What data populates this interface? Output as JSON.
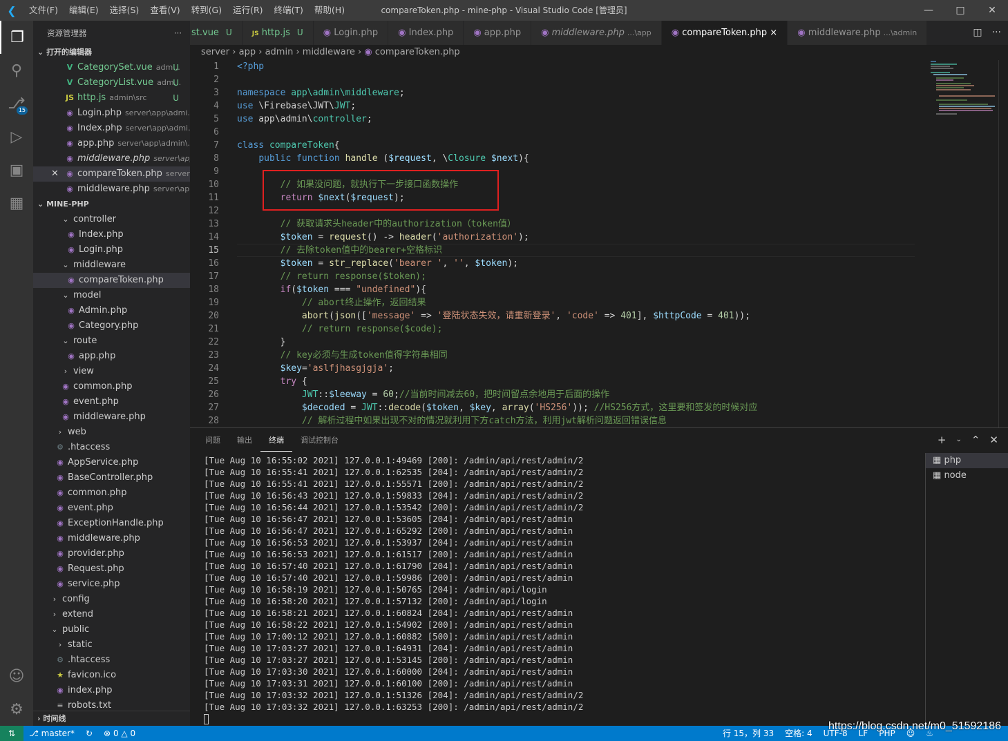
{
  "titlebar": {
    "menus": [
      "文件(F)",
      "编辑(E)",
      "选择(S)",
      "查看(V)",
      "转到(G)",
      "运行(R)",
      "终端(T)",
      "帮助(H)"
    ],
    "title": "compareToken.php - mine-php - Visual Studio Code [管理员]"
  },
  "activity": {
    "badge": "15"
  },
  "sidebar": {
    "title": "资源管理器",
    "more": "···",
    "open_editors_label": "打开的编辑器",
    "project_label": "MINE-PHP",
    "timeline_label": "时间线",
    "open_editors": [
      {
        "name": "CategorySet.vue",
        "desc": "adm...",
        "status": "U"
      },
      {
        "name": "CategoryList.vue",
        "desc": "adm...",
        "status": "U"
      },
      {
        "name": "http.js",
        "desc": "admin\\src",
        "status": "U"
      },
      {
        "name": "Login.php",
        "desc": "server\\app\\admi..."
      },
      {
        "name": "Index.php",
        "desc": "server\\app\\admi..."
      },
      {
        "name": "app.php",
        "desc": "server\\app\\admin\\..."
      },
      {
        "name": "middleware.php",
        "desc": "server\\app"
      },
      {
        "name": "compareToken.php",
        "desc": "server\\..."
      },
      {
        "name": "middleware.php",
        "desc": "server\\app..."
      }
    ],
    "tree": [
      "controller",
      "Index.php",
      "Login.php",
      "middleware",
      "compareToken.php",
      "model",
      "Admin.php",
      "Category.php",
      "route",
      "app.php",
      "view",
      "common.php",
      "event.php",
      "middleware.php",
      "web",
      ".htaccess",
      "AppService.php",
      "BaseController.php",
      "common.php",
      "event.php",
      "ExceptionHandle.php",
      "middleware.php",
      "provider.php",
      "Request.php",
      "service.php",
      "config",
      "extend",
      "public",
      "static",
      ".htaccess",
      "favicon.ico",
      "index.php",
      "robots.txt"
    ]
  },
  "tabs": [
    {
      "label": "st.vue",
      "status": "U"
    },
    {
      "label": "http.js",
      "status": "U"
    },
    {
      "label": "Login.php"
    },
    {
      "label": "Index.php"
    },
    {
      "label": "app.php"
    },
    {
      "label": "middleware.php",
      "desc": "...\\app"
    },
    {
      "label": "compareToken.php",
      "close": "×"
    },
    {
      "label": "middleware.php",
      "desc": "...\\admin"
    }
  ],
  "breadcrumb": [
    "server",
    "app",
    "admin",
    "middleware",
    "compareToken.php"
  ],
  "editor": {
    "line_numbers": [
      "1",
      "2",
      "3",
      "4",
      "5",
      "6",
      "7",
      "8",
      "9",
      "10",
      "11",
      "12",
      "13",
      "14",
      "15",
      "16",
      "17",
      "18",
      "19",
      "20",
      "21",
      "22",
      "23",
      "24",
      "25",
      "26",
      "27",
      "28"
    ],
    "current_line": "15"
  },
  "panel": {
    "tabs": [
      "问题",
      "输出",
      "终端",
      "调试控制台"
    ],
    "terminals": [
      "php",
      "node"
    ],
    "log": [
      "[Tue Aug 10 16:55:02 2021] 127.0.0.1:49469 [200]: /admin/api/rest/admin/2",
      "[Tue Aug 10 16:55:41 2021] 127.0.0.1:62535 [204]: /admin/api/rest/admin/2",
      "[Tue Aug 10 16:55:41 2021] 127.0.0.1:55571 [200]: /admin/api/rest/admin/2",
      "[Tue Aug 10 16:56:43 2021] 127.0.0.1:59833 [204]: /admin/api/rest/admin/2",
      "[Tue Aug 10 16:56:44 2021] 127.0.0.1:53542 [200]: /admin/api/rest/admin/2",
      "[Tue Aug 10 16:56:47 2021] 127.0.0.1:53605 [204]: /admin/api/rest/admin",
      "[Tue Aug 10 16:56:47 2021] 127.0.0.1:65292 [200]: /admin/api/rest/admin",
      "[Tue Aug 10 16:56:53 2021] 127.0.0.1:53937 [204]: /admin/api/rest/admin",
      "[Tue Aug 10 16:56:53 2021] 127.0.0.1:61517 [200]: /admin/api/rest/admin",
      "[Tue Aug 10 16:57:40 2021] 127.0.0.1:61790 [204]: /admin/api/rest/admin",
      "[Tue Aug 10 16:57:40 2021] 127.0.0.1:59986 [200]: /admin/api/rest/admin",
      "[Tue Aug 10 16:58:19 2021] 127.0.0.1:50765 [204]: /admin/api/login",
      "[Tue Aug 10 16:58:20 2021] 127.0.0.1:57132 [200]: /admin/api/login",
      "[Tue Aug 10 16:58:21 2021] 127.0.0.1:60824 [204]: /admin/api/rest/admin",
      "[Tue Aug 10 16:58:22 2021] 127.0.0.1:54902 [200]: /admin/api/rest/admin",
      "[Tue Aug 10 17:00:12 2021] 127.0.0.1:60882 [500]: /admin/api/rest/admin",
      "[Tue Aug 10 17:03:27 2021] 127.0.0.1:64931 [204]: /admin/api/rest/admin",
      "[Tue Aug 10 17:03:27 2021] 127.0.0.1:53145 [200]: /admin/api/rest/admin",
      "[Tue Aug 10 17:03:30 2021] 127.0.0.1:60000 [204]: /admin/api/rest/admin",
      "[Tue Aug 10 17:03:31 2021] 127.0.0.1:60100 [200]: /admin/api/rest/admin",
      "[Tue Aug 10 17:03:32 2021] 127.0.0.1:51326 [204]: /admin/api/rest/admin/2",
      "[Tue Aug 10 17:03:32 2021] 127.0.0.1:63253 [200]: /admin/api/rest/admin/2"
    ]
  },
  "statusbar": {
    "branch": "master*",
    "errors": "0",
    "warnings": "0",
    "position": "行 15，列 33",
    "spaces": "空格: 4",
    "encoding": "UTF-8",
    "eol": "LF",
    "language": "PHP"
  },
  "watermark": "https://blog.csdn.net/m0_51592186",
  "colors": {
    "accent": "#007acc",
    "highlight_box": "#e02020"
  }
}
